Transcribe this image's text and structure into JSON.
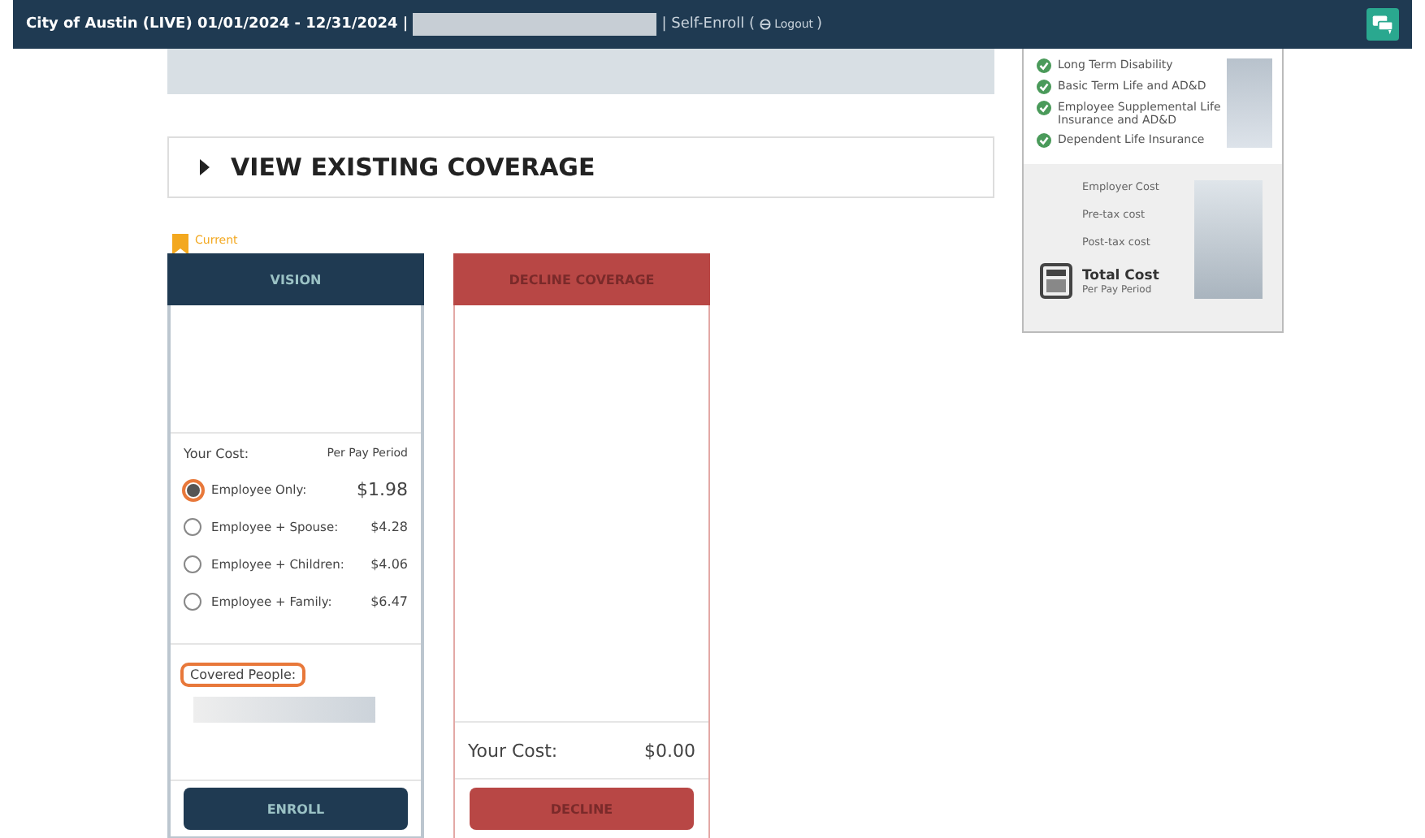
{
  "top_bar": {
    "title": "City of Austin (LIVE) 01/01/2024 - 12/31/2024 |",
    "mode": "| Self-Enroll (",
    "logout": "Logout",
    "close_paren": ")"
  },
  "existing_coverage": {
    "label": "VIEW EXISTING COVERAGE",
    "expanded": false
  },
  "plans": [
    {
      "kind": "enroll",
      "badge": "Current",
      "title": "VISION",
      "cost_label": "Your Cost:",
      "period": "Per Pay Period",
      "options": [
        {
          "label": "Employee Only:",
          "price": "$1.98",
          "selected": true
        },
        {
          "label": "Employee + Spouse:",
          "price": "$4.28",
          "selected": false
        },
        {
          "label": "Employee + Children:",
          "price": "$4.06",
          "selected": false
        },
        {
          "label": "Employee + Family:",
          "price": "$6.47",
          "selected": false
        }
      ],
      "covered_label": "Covered People:",
      "button": "ENROLL"
    },
    {
      "kind": "decline",
      "title": "DECLINE COVERAGE",
      "cost_label": "Your Cost:",
      "cost": "$0.00",
      "button": "DECLINE"
    }
  ],
  "summary": {
    "benefits": [
      "Long Term Disability",
      "Basic Term Life and AD&D",
      "Employee Supplemental Life Insurance and AD&D",
      "Dependent Life Insurance"
    ],
    "costs": [
      "Employer Cost",
      "Pre-tax cost",
      "Post-tax cost"
    ],
    "total_label": "Total Cost",
    "total_sub": "Per Pay Period"
  }
}
